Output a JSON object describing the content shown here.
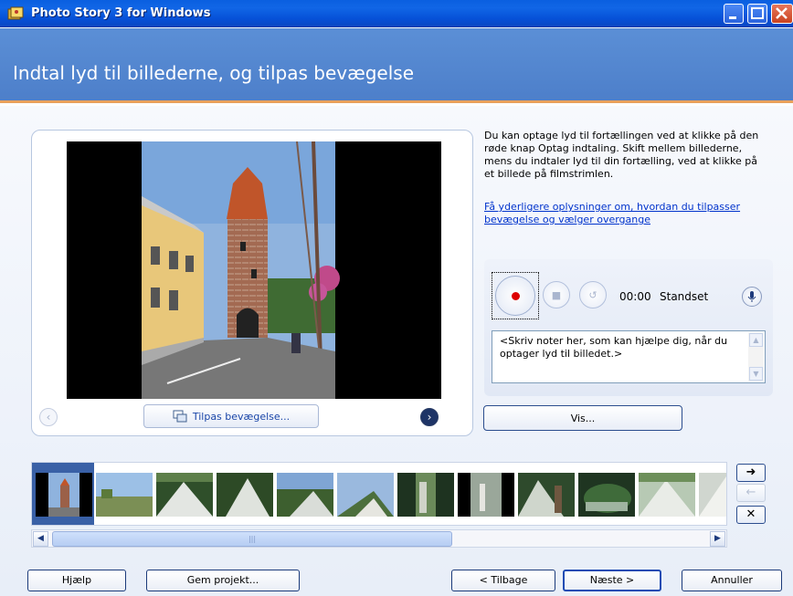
{
  "window": {
    "title": "Photo Story 3 for Windows"
  },
  "header": {
    "title": "Indtal lyd til billederne, og tilpas bevægelse"
  },
  "preview": {
    "customize_motion_label": "Tilpas bevægelse..."
  },
  "instructions": {
    "text": "Du kan optage lyd til fortællingen ved at klikke på den røde knap Optag indtaling. Skift mellem billederne, mens du indtaler lyd til din fortælling, ved at klikke på et billede på filmstrimlen.",
    "link": "Få yderligere oplysninger om, hvordan du tilpasser bevægelse og vælger overgange"
  },
  "recorder": {
    "time": "00:00",
    "status": "Standset",
    "notes_placeholder": "<Skriv noter her, som kan hjælpe dig, når du optager lyd til billedet.>"
  },
  "vis_button": "Vis...",
  "filmstrip": {
    "thumbnail_count": 12,
    "selected_index": 0
  },
  "footer": {
    "help": "Hjælp",
    "save_project": "Gem projekt...",
    "back": "< Tilbage",
    "next": "Næste >",
    "cancel": "Annuller"
  },
  "colors": {
    "title_bar": "#0a5fe0",
    "header": "#5b8fd6",
    "accent_line": "#e9a15c",
    "record_dot": "#dd0000"
  }
}
